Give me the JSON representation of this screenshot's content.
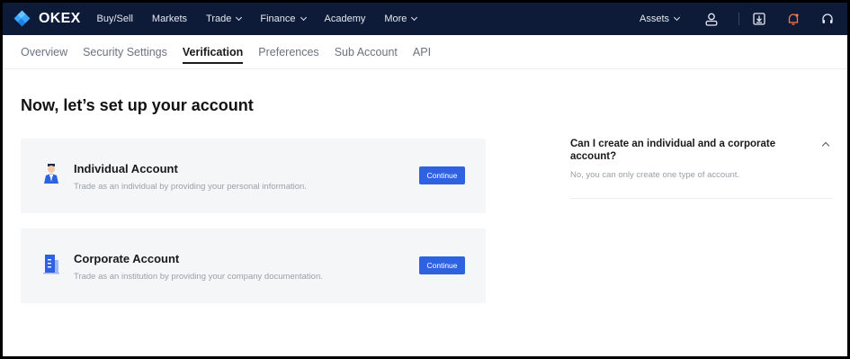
{
  "brand": {
    "name": "OKEX"
  },
  "topnav": {
    "items": [
      {
        "label": "Buy/Sell",
        "has_menu": false
      },
      {
        "label": "Markets",
        "has_menu": false
      },
      {
        "label": "Trade",
        "has_menu": true
      },
      {
        "label": "Finance",
        "has_menu": true
      },
      {
        "label": "Academy",
        "has_menu": false
      },
      {
        "label": "More",
        "has_menu": true
      }
    ],
    "assets_label": "Assets",
    "icons": [
      "user-icon",
      "download-icon",
      "bell-icon",
      "headset-icon"
    ]
  },
  "subnav": {
    "tabs": [
      {
        "label": "Overview",
        "active": false
      },
      {
        "label": "Security Settings",
        "active": false
      },
      {
        "label": "Verification",
        "active": true
      },
      {
        "label": "Preferences",
        "active": false
      },
      {
        "label": "Sub Account",
        "active": false
      },
      {
        "label": "API",
        "active": false
      }
    ]
  },
  "main": {
    "heading": "Now, let’s set up your account",
    "cards": [
      {
        "title": "Individual Account",
        "description": "Trade as an individual by providing your personal information.",
        "button_label": "Continue",
        "icon": "person-icon"
      },
      {
        "title": "Corporate Account",
        "description": "Trade as an institution by providing your company documentation.",
        "button_label": "Continue",
        "icon": "building-icon"
      }
    ]
  },
  "faq": {
    "question": "Can I create an individual and a corporate account?",
    "answer": "No, you can only create one type of account.",
    "expanded": true
  },
  "colors": {
    "nav_bg": "#0d1a38",
    "accent": "#2d63e0",
    "card_bg": "#f5f6f8",
    "logo_blue": "#3aa7ff"
  }
}
